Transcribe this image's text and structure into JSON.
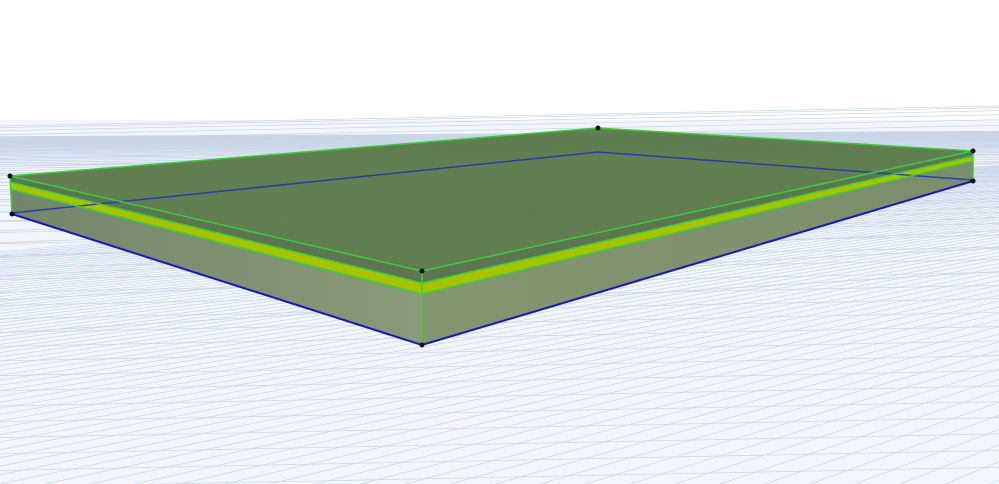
{
  "view": {
    "title": "",
    "type_label": ""
  },
  "colors": {
    "background": "#ffffff",
    "floor": "#f1f5fb",
    "grid": "#c9d6e8",
    "slab_top": "#5b7a4a",
    "slab_side": "#7d8f6e",
    "slab_top_layer": "#55703f",
    "stripe": "#a8c400",
    "edge_green": "#3cc43c",
    "edge_blue": "#1a1ac8",
    "vertex": "#111111"
  }
}
